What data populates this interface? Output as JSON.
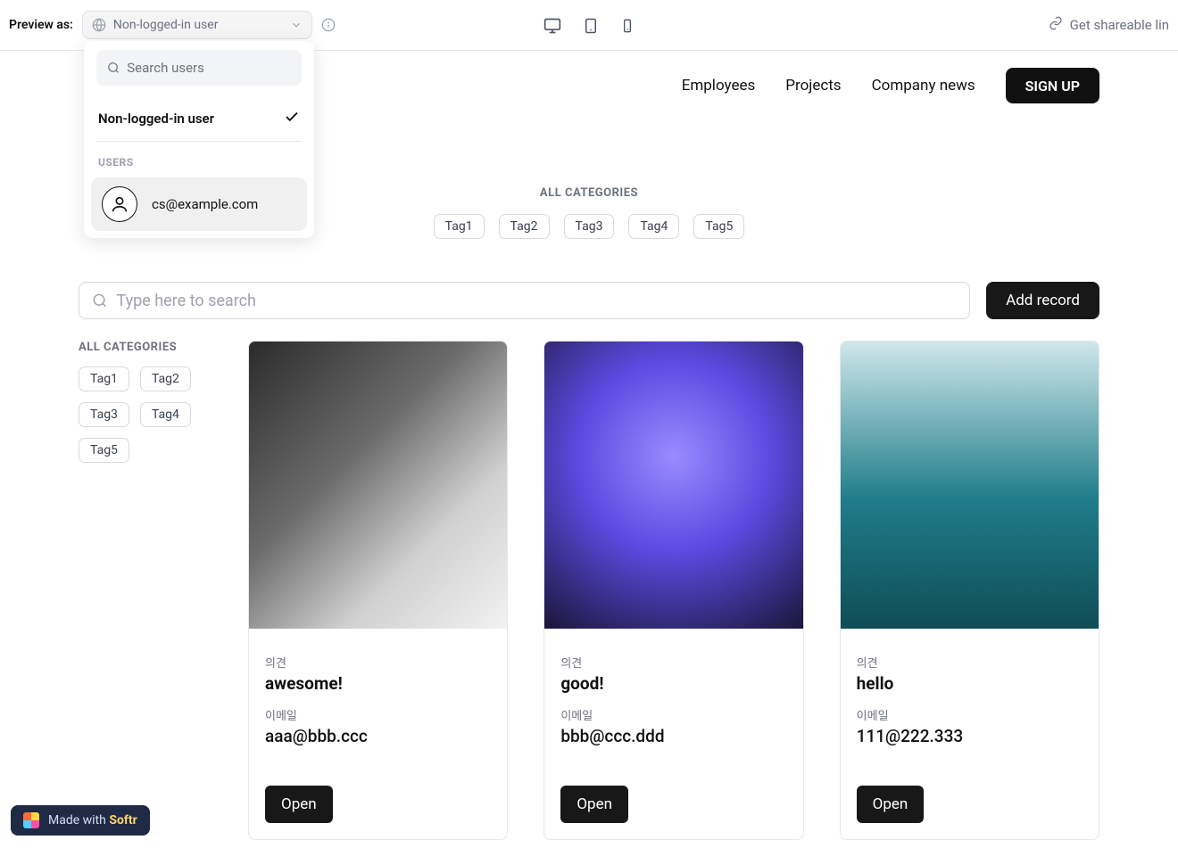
{
  "preview_bar": {
    "label": "Preview as:",
    "selected": "Non-logged-in user",
    "share": "Get shareable lin"
  },
  "dropdown": {
    "search_placeholder": "Search users",
    "non_logged_in": "Non-logged-in user",
    "users_label": "USERS",
    "user_email": "cs@example.com"
  },
  "nav": {
    "employees": "Employees",
    "projects": "Projects",
    "company_news": "Company news",
    "signup": "SIGN UP"
  },
  "categories": {
    "label": "ALL CATEGORIES",
    "tags": [
      "Tag1",
      "Tag2",
      "Tag3",
      "Tag4",
      "Tag5"
    ]
  },
  "search": {
    "placeholder": "Type here to search",
    "add_record": "Add record"
  },
  "side_categories": {
    "label": "ALL CATEGORIES",
    "tags": [
      "Tag1",
      "Tag2",
      "Tag3",
      "Tag4",
      "Tag5"
    ]
  },
  "cards": [
    {
      "opinion_label": "의견",
      "opinion": "awesome!",
      "email_label": "이메일",
      "email": "aaa@bbb.ccc",
      "open": "Open"
    },
    {
      "opinion_label": "의견",
      "opinion": "good!",
      "email_label": "이메일",
      "email": "bbb@ccc.ddd",
      "open": "Open"
    },
    {
      "opinion_label": "의견",
      "opinion": "hello",
      "email_label": "이메일",
      "email": "111@222.333",
      "open": "Open"
    }
  ],
  "softr": {
    "prefix": "Made with ",
    "brand": "Softr"
  }
}
